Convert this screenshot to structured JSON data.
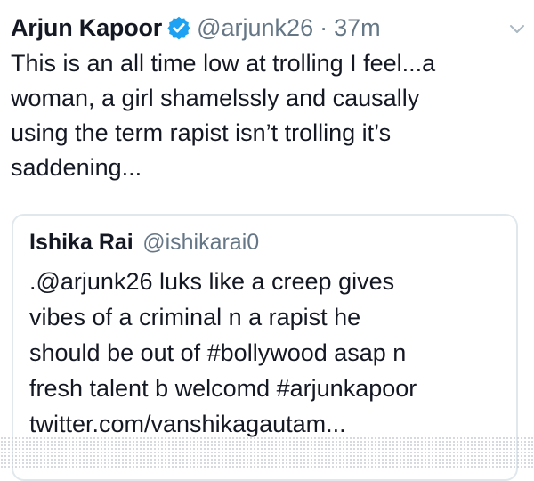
{
  "tweet": {
    "author_name": "Arjun Kapoor",
    "author_handle": "@arjunk26",
    "separator": "·",
    "time": "37m",
    "verified_icon": "verified-badge-icon",
    "caret_icon": "chevron-down-icon",
    "text_lines": [
      "This is an all time low at trolling I feel...a",
      "woman, a girl shamelssly and causally",
      "using the term rapist isn’t trolling it’s",
      "saddening..."
    ]
  },
  "quoted_tweet": {
    "author_name": "Ishika Rai",
    "author_handle": "@ishikarai0",
    "text_lines": [
      ".@arjunk26 luks like a creep gives",
      "vibes of a criminal n a rapist he",
      "should be out of #bollywood asap n",
      "fresh talent b welcomd #arjunkapoor",
      "twitter.com/vanshikagautam..."
    ]
  },
  "colors": {
    "text": "#141823",
    "secondary_text": "#657786",
    "verified_blue": "#1da1f2",
    "card_border": "#e1e8ed"
  }
}
